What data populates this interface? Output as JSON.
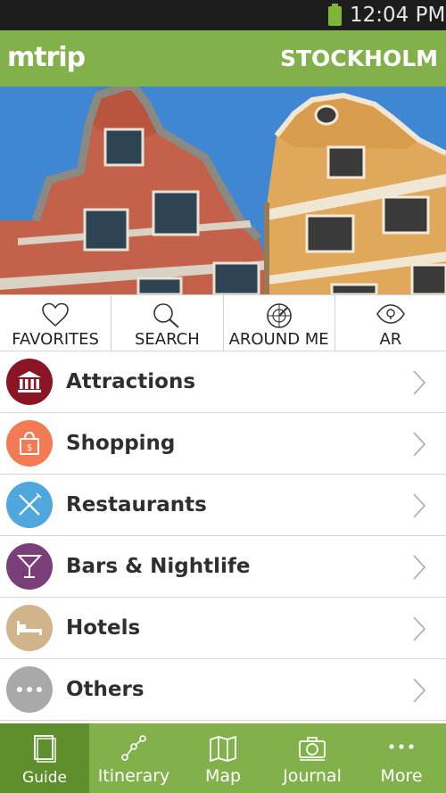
{
  "status_bar": {
    "time": "12:04 PM"
  },
  "header": {
    "logo": "mtrip",
    "city": "STOCKHOLM"
  },
  "hero": {
    "icon": "stockholm-facades-photo"
  },
  "quick_actions": [
    {
      "label": "FAVORITES",
      "icon": "heart-icon"
    },
    {
      "label": "SEARCH",
      "icon": "search-icon"
    },
    {
      "label": "AROUND ME",
      "icon": "radar-icon"
    },
    {
      "label": "AR",
      "icon": "eye-icon"
    }
  ],
  "categories": [
    {
      "label": "Attractions",
      "icon": "museum-icon",
      "color": "#8a1525"
    },
    {
      "label": "Shopping",
      "icon": "shopping-bag-icon",
      "color": "#f27a55"
    },
    {
      "label": "Restaurants",
      "icon": "cutlery-icon",
      "color": "#4fa7de"
    },
    {
      "label": "Bars & Nightlife",
      "icon": "cocktail-icon",
      "color": "#7a3f78"
    },
    {
      "label": "Hotels",
      "icon": "bed-icon",
      "color": "#d1b48a"
    },
    {
      "label": "Others",
      "icon": "more-dots-icon",
      "color": "#a9a9a9"
    }
  ],
  "bottom_nav": [
    {
      "label": "Guide",
      "icon": "book-icon",
      "active": true
    },
    {
      "label": "Itinerary",
      "icon": "route-icon",
      "active": false
    },
    {
      "label": "Map",
      "icon": "map-icon",
      "active": false
    },
    {
      "label": "Journal",
      "icon": "camera-icon",
      "active": false
    },
    {
      "label": "More",
      "icon": "more-dots-icon",
      "active": false
    }
  ],
  "colors": {
    "brand_green": "#82b14b",
    "active_tab_green": "#5f8e2d",
    "status_bar": "#1d1d1d"
  }
}
